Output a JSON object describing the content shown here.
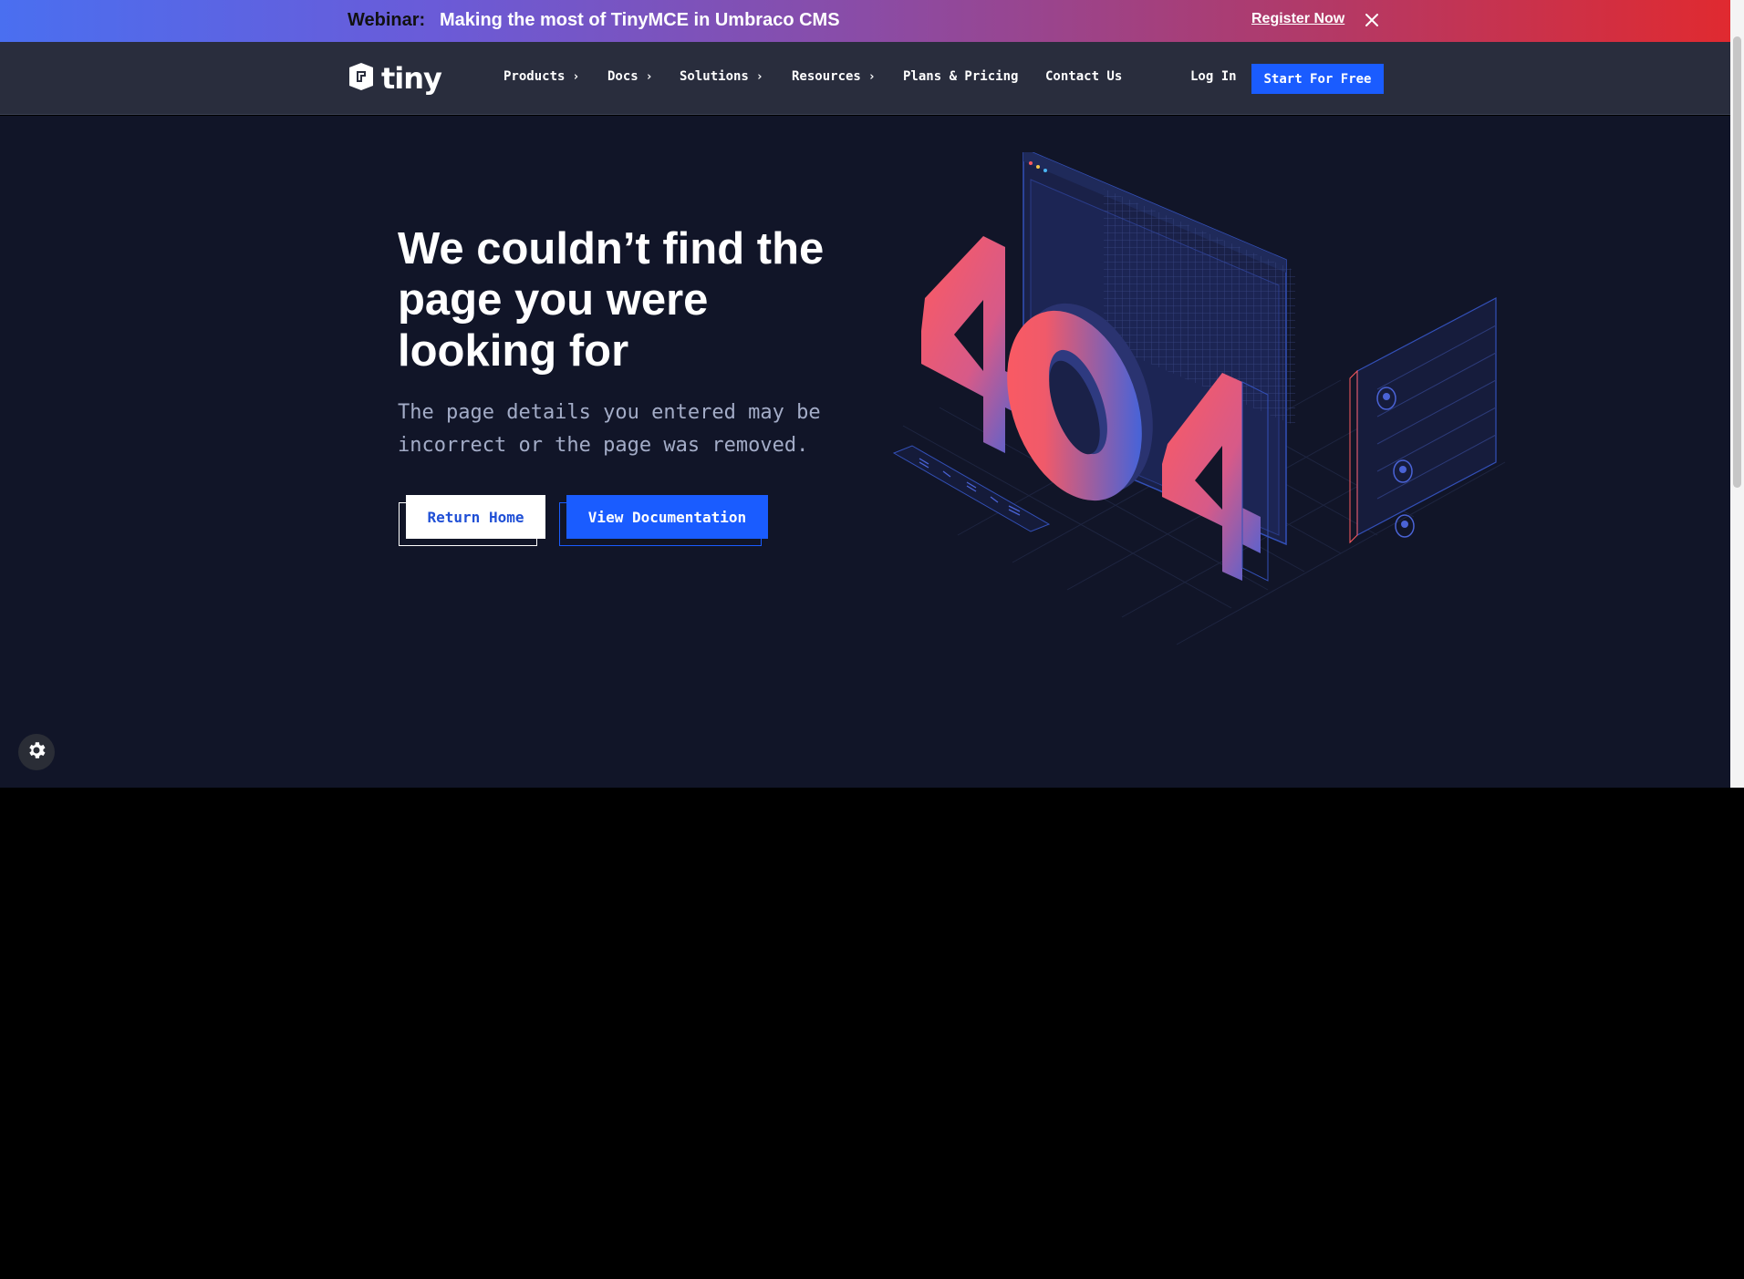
{
  "banner": {
    "label": "Webinar:",
    "title": "Making the most of TinyMCE in Umbraco CMS",
    "cta": "Register Now",
    "close_icon": "close-icon"
  },
  "nav": {
    "logo_text": "tiny",
    "items": [
      {
        "label": "Products",
        "has_submenu": true
      },
      {
        "label": "Docs",
        "has_submenu": true
      },
      {
        "label": "Solutions",
        "has_submenu": true
      },
      {
        "label": "Resources",
        "has_submenu": true
      },
      {
        "label": "Plans & Pricing",
        "has_submenu": false
      },
      {
        "label": "Contact Us",
        "has_submenu": false
      }
    ],
    "login": "Log In",
    "start": "Start For Free"
  },
  "main": {
    "headline": "We couldn’t find the page you were looking for",
    "subtext": "The page details you entered may be incorrect or the page was removed.",
    "return_home": "Return Home",
    "view_docs": "View Documentation",
    "illustration_digits": [
      "4",
      "0",
      "4"
    ]
  },
  "colors": {
    "accent": "#1a5cff",
    "background": "#111528",
    "nav_background": "#292d3d",
    "gradient_red": "#ff5a5f",
    "gradient_blue": "#4a63d6"
  },
  "icons": {
    "settings": "gear-icon",
    "chevron": "chevron-right-icon",
    "logo": "tiny-logo-icon"
  }
}
